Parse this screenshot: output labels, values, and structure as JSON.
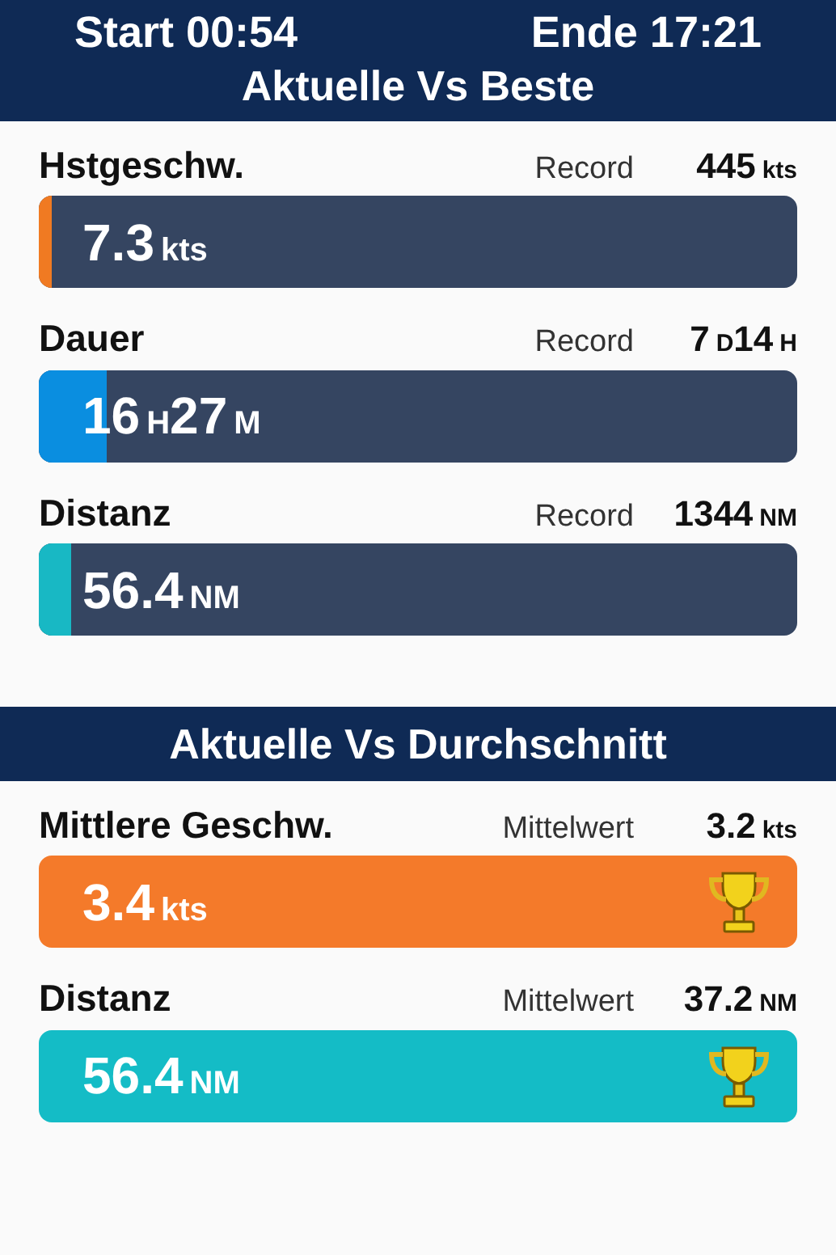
{
  "top_bar": {
    "start": "Start 00:54",
    "end": "Ende 17:21"
  },
  "sections": [
    {
      "title": "Aktuelle Vs Beste",
      "metrics": [
        {
          "label": "Hstgeschw.",
          "ref_label": "Record",
          "ref_value": [
            {
              "text": "445",
              "kind": "num"
            },
            {
              "text": "kts",
              "kind": "unit"
            }
          ],
          "value": [
            {
              "text": "7.3",
              "kind": "num"
            },
            {
              "text": "kts",
              "kind": "unit"
            }
          ],
          "color": "#f07a22",
          "level": 0.016,
          "trophy": false
        },
        {
          "label": "Dauer",
          "ref_label": "Record",
          "ref_value": [
            {
              "text": "7",
              "kind": "num"
            },
            {
              "text": "D",
              "kind": "unit"
            },
            {
              "text": "14",
              "kind": "num"
            },
            {
              "text": "H",
              "kind": "unit"
            }
          ],
          "value": [
            {
              "text": "16",
              "kind": "num"
            },
            {
              "text": "H",
              "kind": "unit"
            },
            {
              "text": "27",
              "kind": "num"
            },
            {
              "text": "M",
              "kind": "unit"
            }
          ],
          "color": "#0a8ee0",
          "level": 0.09,
          "trophy": false
        },
        {
          "label": "Distanz",
          "ref_label": "Record",
          "ref_value": [
            {
              "text": "1344",
              "kind": "num"
            },
            {
              "text": "NM",
              "kind": "unit"
            }
          ],
          "value": [
            {
              "text": "56.4",
              "kind": "num"
            },
            {
              "text": "NM",
              "kind": "unit"
            }
          ],
          "color": "#18b8c4",
          "level": 0.042,
          "trophy": false
        }
      ]
    },
    {
      "title": "Aktuelle Vs Durchschnitt",
      "metrics": [
        {
          "label": "Mittlere Geschw.",
          "ref_label": "Mittelwert",
          "ref_value": [
            {
              "text": "3.2",
              "kind": "num"
            },
            {
              "text": "kts",
              "kind": "unit"
            }
          ],
          "value": [
            {
              "text": "3.4",
              "kind": "num"
            },
            {
              "text": "kts",
              "kind": "unit"
            }
          ],
          "color": "#f47a2a",
          "trophy": true
        },
        {
          "label": "Distanz",
          "ref_label": "Mittelwert",
          "ref_value": [
            {
              "text": "37.2",
              "kind": "num"
            },
            {
              "text": "NM",
              "kind": "unit"
            }
          ],
          "value": [
            {
              "text": "56.4",
              "kind": "num"
            },
            {
              "text": "NM",
              "kind": "unit"
            }
          ],
          "color": "#14bcc6",
          "trophy": true
        }
      ]
    }
  ]
}
